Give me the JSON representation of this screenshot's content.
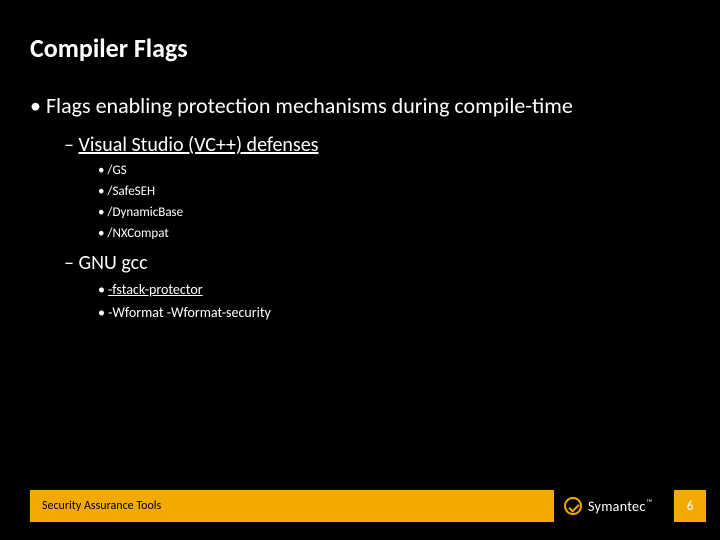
{
  "title": "Compiler Flags",
  "main_bullet": "Flags enabling protection mechanisms during compile-time",
  "vs": {
    "label": "Visual Studio (VC++) defenses",
    "items": [
      "/GS",
      "/SafeSEH",
      "/DynamicBase",
      "/NXCompat"
    ]
  },
  "gcc": {
    "label": "GNU gcc",
    "items": [
      "-fstack-protector",
      "-Wformat  -Wformat-security"
    ]
  },
  "footer": {
    "label": "Security Assurance Tools",
    "brand": "Symantec",
    "page": "6"
  }
}
